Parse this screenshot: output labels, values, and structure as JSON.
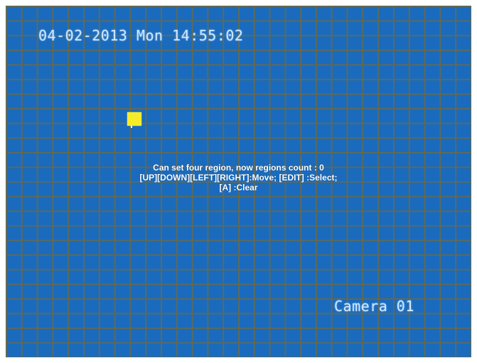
{
  "osd": {
    "datetime": "04-02-2013 Mon 14:55:02",
    "camera_name": "Camera 01"
  },
  "region_dialog": {
    "line1": "Can set four region,  now regions count : 0",
    "line2": "[UP][DOWN][LEFT][RIGHT]:Move; [EDIT] :Select;",
    "line3": "[A] :Clear"
  },
  "colors": {
    "background": "#1a6bbd",
    "grid": "#5e6a5a",
    "cursor": "#f7ec2a",
    "osd_text": "#cfe8ff"
  },
  "icons": {
    "cursor": "selection-cursor-icon"
  }
}
